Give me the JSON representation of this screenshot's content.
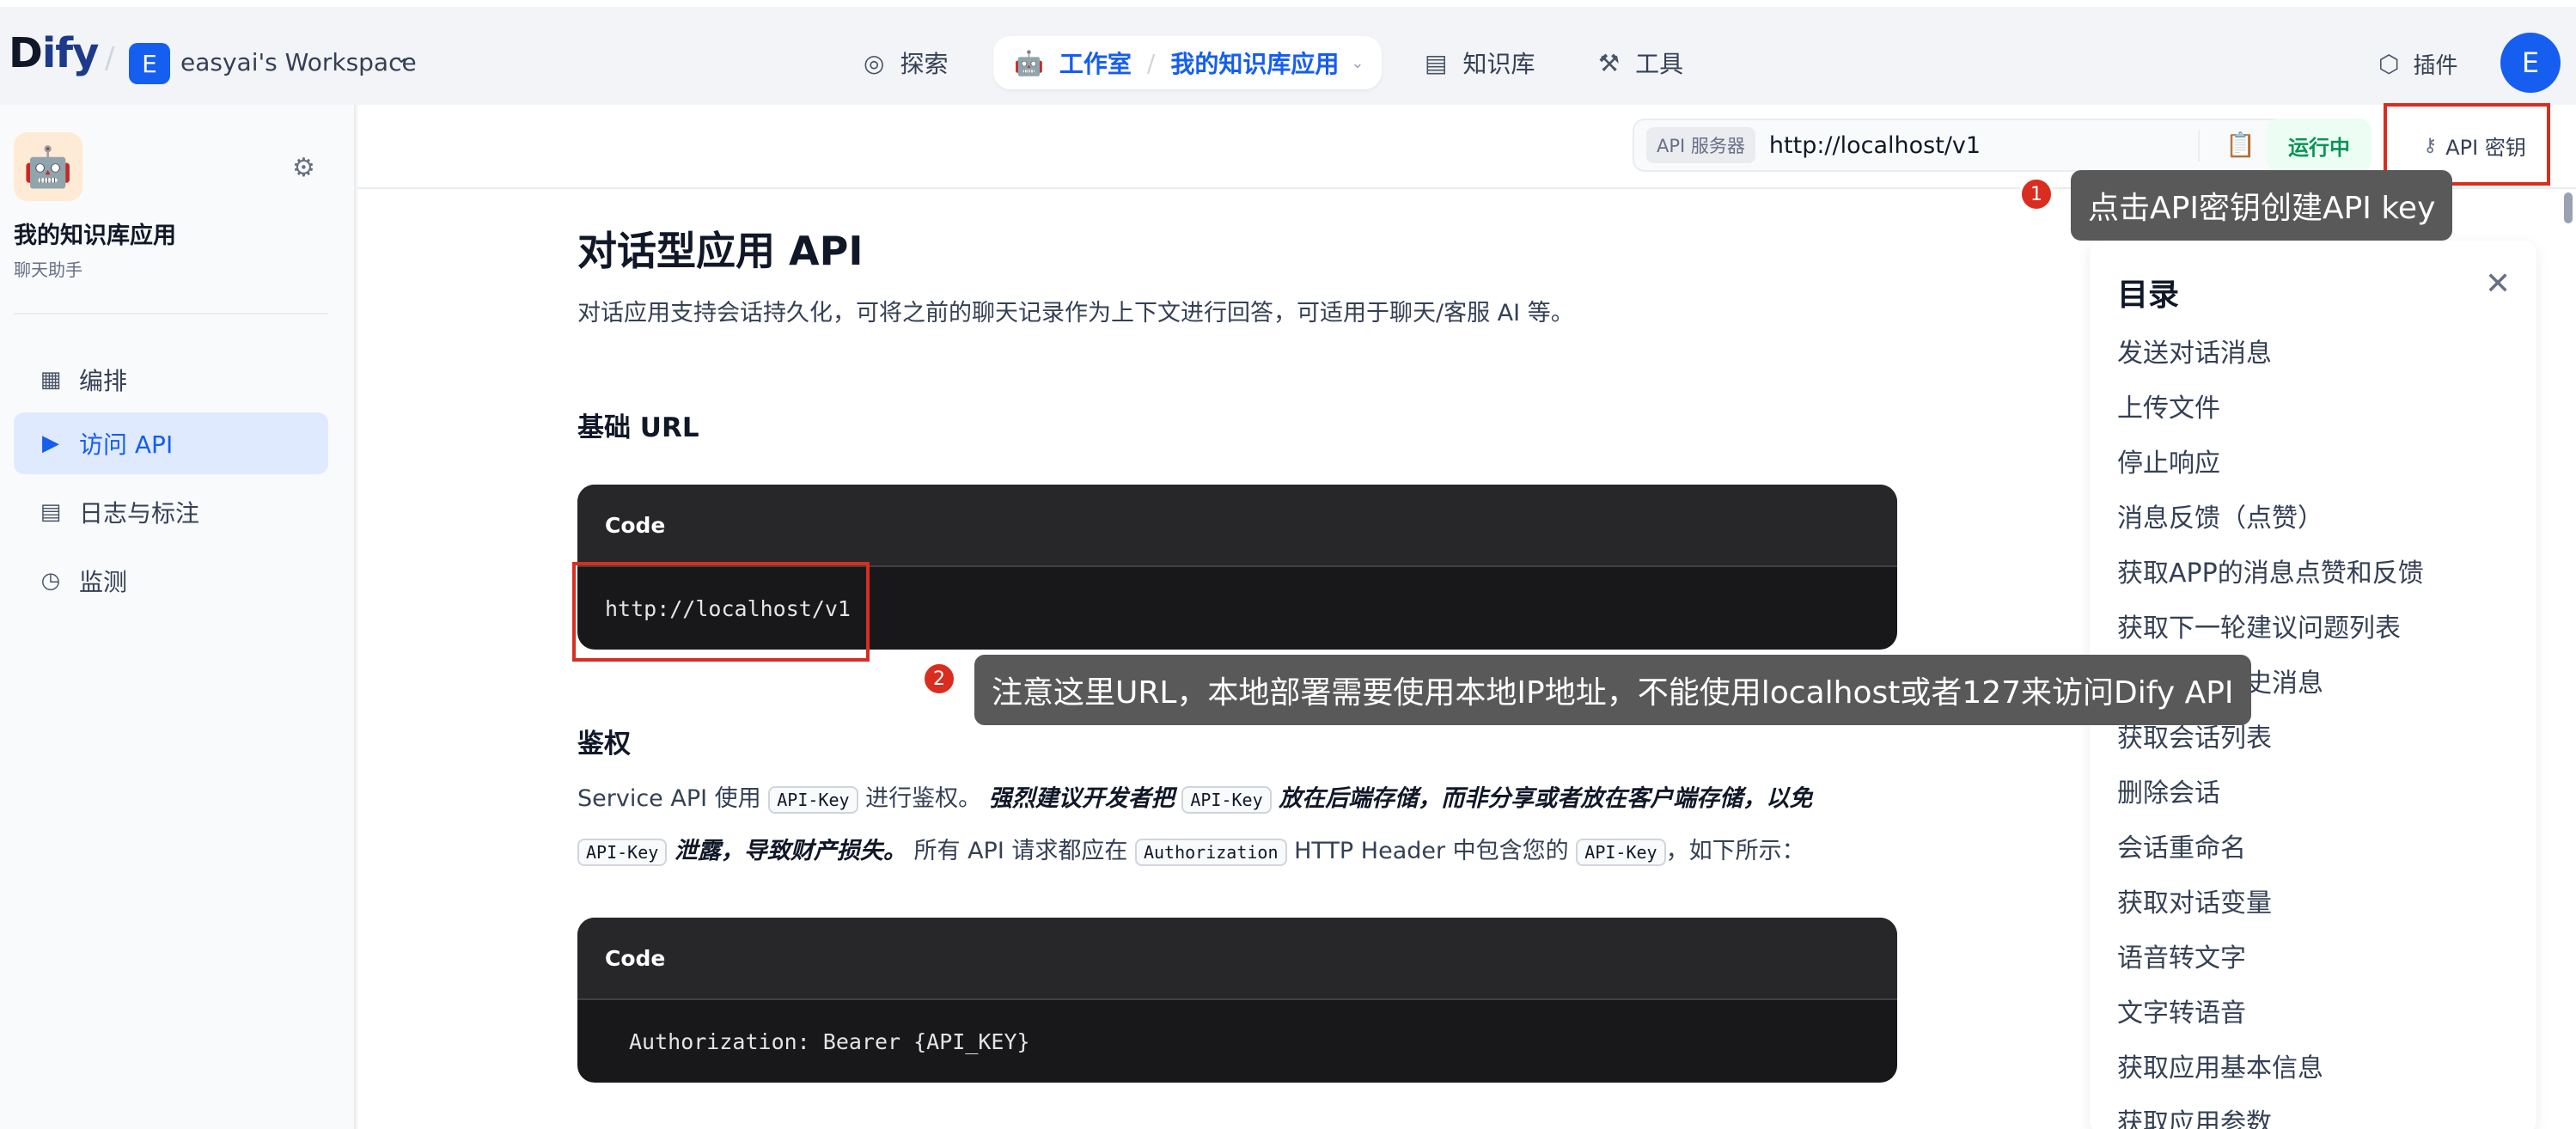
{
  "nav": {
    "logo_d": "D",
    "logo_ify": "ify",
    "workspace_initial": "E",
    "workspace_name": "easyai's Workspace",
    "explore": "探索",
    "studio": "工作室",
    "current_app": "我的知识库应用",
    "knowledge": "知识库",
    "tools": "工具",
    "plugins": "插件",
    "user_initial": "E"
  },
  "sidebar": {
    "app_name": "我的知识库应用",
    "app_type": "聊天助手",
    "items": [
      {
        "label": "编排"
      },
      {
        "label": "访问 API"
      },
      {
        "label": "日志与标注"
      },
      {
        "label": "监测"
      }
    ]
  },
  "toolbar": {
    "api_server_tag": "API 服务器",
    "api_server_url": "http://localhost/v1",
    "status": "运行中",
    "api_key_label": "API 密钥"
  },
  "doc": {
    "title": "对话型应用 API",
    "lead": "对话应用支持会话持久化，可将之前的聊天记录作为上下文进行回答，可适用于聊天/客服 AI 等。",
    "base_url_heading": "基础 URL",
    "code_label_1": "Code",
    "code_1": "http://localhost/v1",
    "auth_heading": "鉴权",
    "auth_p1": "Service API 使用",
    "auth_code_1": "API-Key",
    "auth_p2": "进行鉴权。",
    "auth_bold_1": "强烈建议开发者把",
    "auth_code_2": "API-Key",
    "auth_bold_2": "放在后端存储，而非分享或者放在客户端存储，以免",
    "auth_code_3": "API-Key",
    "auth_bold_3": "泄露，导致财产损失。",
    "auth_p3": "所有 API 请求都应在",
    "auth_code_4": "Authorization",
    "auth_p4": "HTTP Header 中包含您的",
    "auth_code_5": "API-Key",
    "auth_p5": "，如下所示：",
    "code_label_2": "Code",
    "code_2": "Authorization: Bearer {API_KEY}"
  },
  "toc": {
    "title": "目录",
    "items": [
      "发送对话消息",
      "上传文件",
      "停止响应",
      "消息反馈（点赞）",
      "获取APP的消息点赞和反馈",
      "获取下一轮建议问题列表",
      "获取会话历史消息",
      "获取会话列表",
      "删除会话",
      "会话重命名",
      "获取对话变量",
      "语音转文字",
      "文字转语音",
      "获取应用基本信息",
      "获取应用参数"
    ]
  },
  "annotations": {
    "n1": "1",
    "tip1": "点击API密钥创建API key",
    "n2": "2",
    "tip2": "注意这里URL，本地部署需要使用本地IP地址，不能使用localhost或者127来访问Dify API"
  }
}
